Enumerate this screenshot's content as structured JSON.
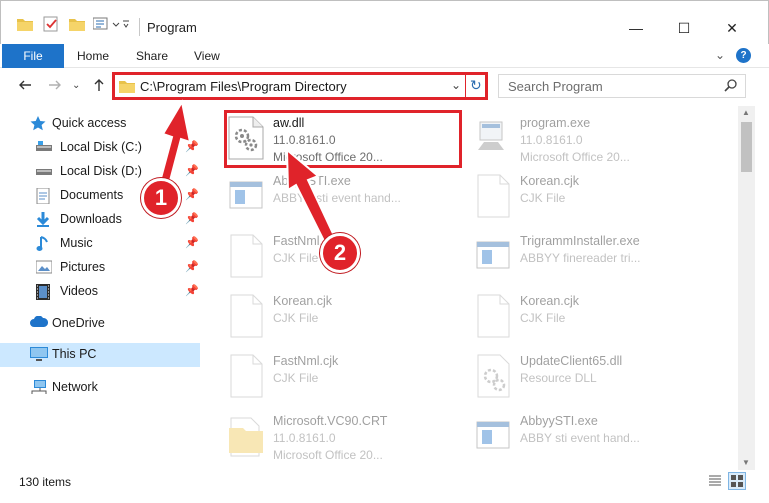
{
  "window": {
    "title": "Program",
    "minimize_glyph": "—",
    "maximize_glyph": "☐",
    "close_glyph": "✕"
  },
  "ribbon": {
    "file": "File",
    "tabs": [
      "Home",
      "Share",
      "View"
    ]
  },
  "address": {
    "path": "C:\\Program Files\\Program Directory",
    "search_placeholder": "Search Program"
  },
  "nav": {
    "quick_access": "Quick access",
    "quick_items": [
      {
        "label": "Local Disk (C:)",
        "icon": "drive-icon"
      },
      {
        "label": "Local Disk (D:)",
        "icon": "drive-icon"
      },
      {
        "label": "Documents",
        "icon": "documents-icon"
      },
      {
        "label": "Downloads",
        "icon": "downloads-icon"
      },
      {
        "label": "Music",
        "icon": "music-icon"
      },
      {
        "label": "Pictures",
        "icon": "pictures-icon"
      },
      {
        "label": "Videos",
        "icon": "videos-icon"
      }
    ],
    "onedrive": "OneDrive",
    "this_pc": "This PC",
    "network": "Network"
  },
  "files": [
    {
      "name": "aw.dll",
      "line2": "11.0.8161.0",
      "line3": "Microsoft Office 20...",
      "icon": "dll-icon"
    },
    {
      "name": "program.exe",
      "line2": "11.0.8161.0",
      "line3": "Microsoft Office 20...",
      "icon": "exe-icon"
    },
    {
      "name": "AbbyySTI.exe",
      "line2": "ABBYY sti event hand...",
      "line3": "",
      "icon": "exe-icon"
    },
    {
      "name": "Korean.cjk",
      "line2": "CJK File",
      "line3": "",
      "icon": "file-icon"
    },
    {
      "name": "FastNml.cjk",
      "line2": "CJK File",
      "line3": "",
      "icon": "file-icon"
    },
    {
      "name": "TrigrammInstaller.exe",
      "line2": "ABBYY finereader tri...",
      "line3": "",
      "icon": "exe-icon"
    },
    {
      "name": "Korean.cjk",
      "line2": "CJK File",
      "line3": "",
      "icon": "file-icon"
    },
    {
      "name": "Korean.cjk",
      "line2": "CJK File",
      "line3": "",
      "icon": "file-icon"
    },
    {
      "name": "FastNml.cjk",
      "line2": "CJK File",
      "line3": "",
      "icon": "file-icon"
    },
    {
      "name": "UpdateClient65.dll",
      "line2": "Resource DLL",
      "line3": "",
      "icon": "dll-icon"
    },
    {
      "name": "Microsoft.VC90.CRT",
      "line2": "11.0.8161.0",
      "line3": "Microsoft Office 20...",
      "icon": "folder-icon"
    },
    {
      "name": "AbbyySTI.exe",
      "line2": "ABBY sti event hand...",
      "line3": "",
      "icon": "exe-icon"
    }
  ],
  "status": {
    "items": "130 items"
  },
  "callouts": [
    "1",
    "2"
  ],
  "colors": {
    "accent": "#1e73c9",
    "highlight": "#e0232a",
    "selected": "#cce8ff"
  }
}
